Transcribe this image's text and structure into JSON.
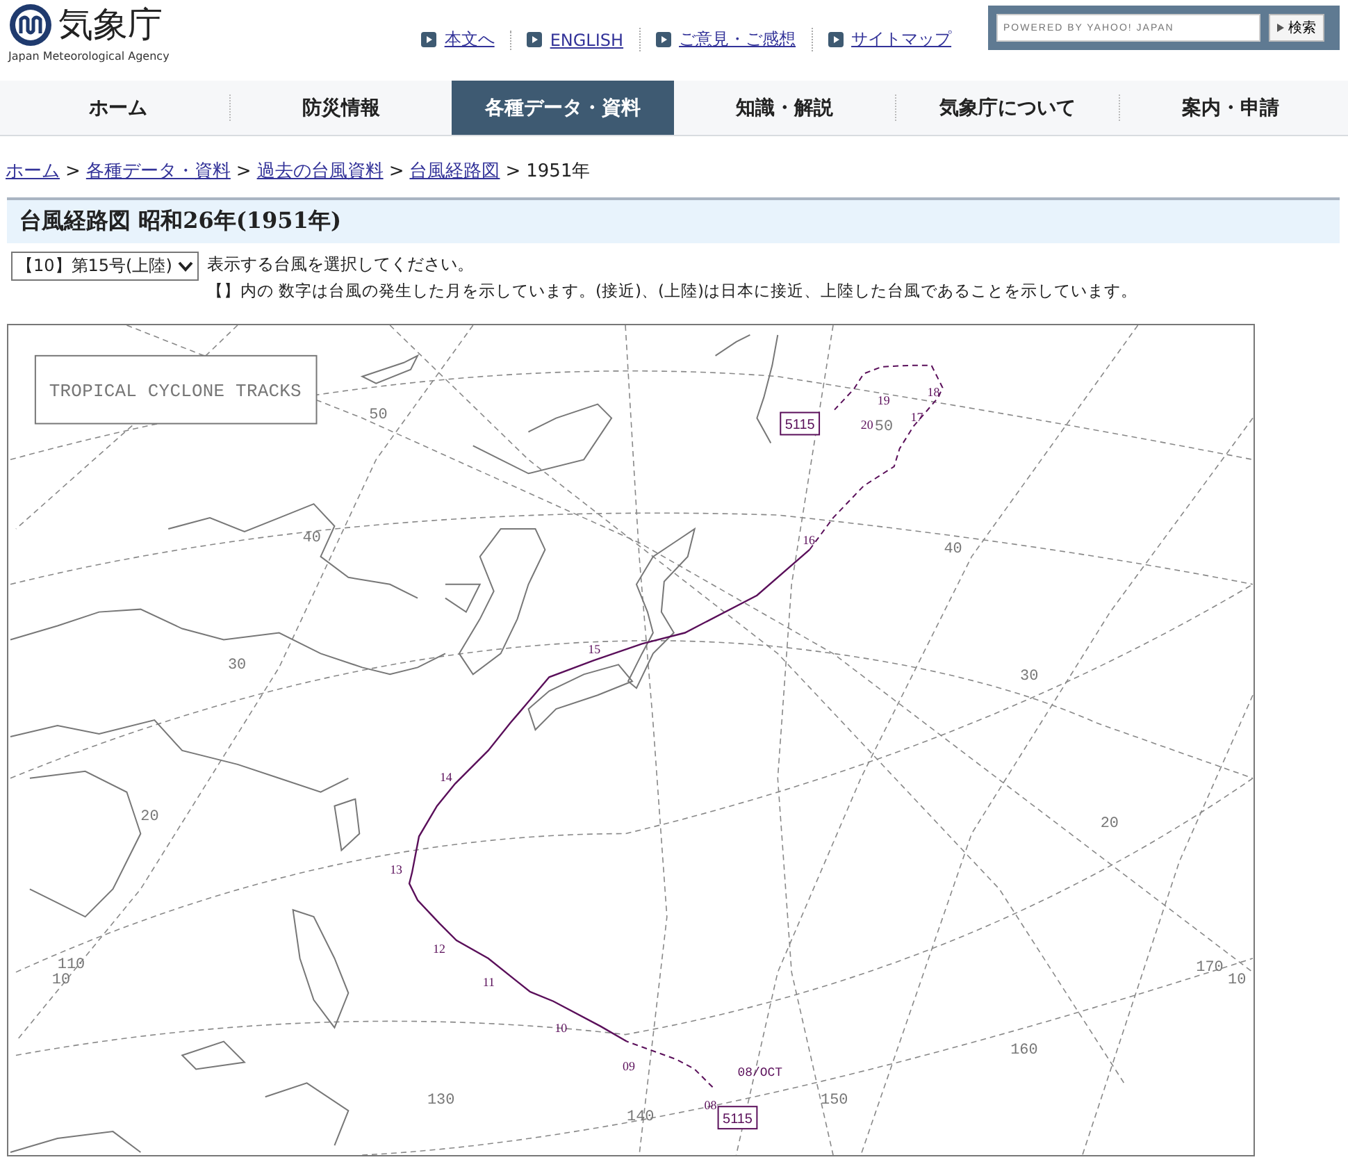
{
  "header": {
    "logo_text": "気象庁",
    "logo_subtitle": "Japan Meteorological Agency",
    "links": [
      {
        "label": "本文へ"
      },
      {
        "label": "ENGLISH"
      },
      {
        "label": "ご意見・ご感想"
      },
      {
        "label": "サイトマップ"
      }
    ],
    "search": {
      "placeholder": "POWERED BY YAHOO! JAPAN",
      "button": "検索"
    }
  },
  "nav": [
    {
      "label": "ホーム",
      "selected": false
    },
    {
      "label": "防災情報",
      "selected": false
    },
    {
      "label": "各種データ・資料",
      "selected": true
    },
    {
      "label": "知識・解説",
      "selected": false
    },
    {
      "label": "気象庁について",
      "selected": false
    },
    {
      "label": "案内・申請",
      "selected": false
    }
  ],
  "breadcrumb": {
    "separator": ">",
    "items": [
      {
        "label": "ホーム",
        "link": true
      },
      {
        "label": "各種データ・資料",
        "link": true
      },
      {
        "label": "過去の台風資料",
        "link": true
      },
      {
        "label": "台風経路図",
        "link": true
      },
      {
        "label": "1951年",
        "link": false
      }
    ]
  },
  "page_title": "台風経路図 昭和26年(1951年)",
  "typhoon_select": {
    "value": "【10】第15号(上陸)",
    "hint": "表示する台風を選択してください。"
  },
  "note": "【】内の 数字は台風の発生した月を示しています。(接近)、(上陸)は日本に接近、上陸した台風であることを示しています。",
  "map": {
    "title": "TROPICAL CYCLONE TRACKS",
    "storm_id_labels": [
      "5115",
      "5115"
    ],
    "start_label": "08/OCT",
    "day_labels": [
      "08",
      "09",
      "10",
      "11",
      "12",
      "13",
      "14",
      "15",
      "16",
      "17",
      "18",
      "19",
      "20"
    ],
    "grid_labels": [
      "50",
      "40",
      "30",
      "20",
      "110",
      "10",
      "130",
      "140",
      "150",
      "160",
      "170",
      "10",
      "40",
      "30",
      "20",
      "50"
    ]
  }
}
